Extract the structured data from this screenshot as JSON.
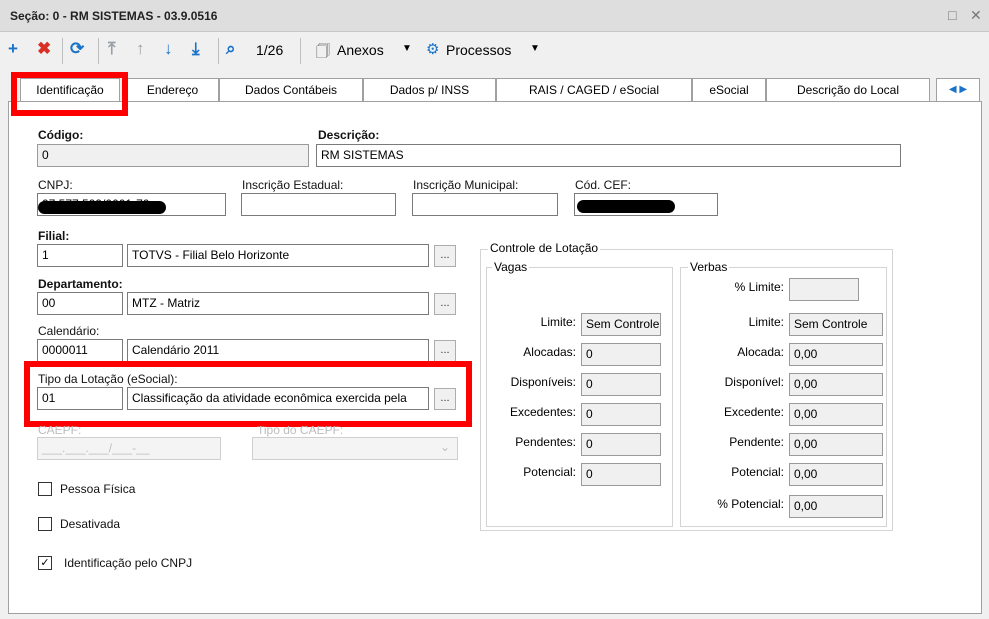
{
  "window": {
    "title": "Seção: 0 - RM SISTEMAS - 03.9.0516",
    "restore": "□",
    "close": "✕"
  },
  "toolbar": {
    "record_counter": "1/26",
    "attachments": "Anexos",
    "processes": "Processos"
  },
  "tabs": [
    "Identificação",
    "Endereço",
    "Dados Contábeis",
    "Dados p/ INSS",
    "RAIS / CAGED / eSocial",
    "eSocial",
    "Descrição do Local"
  ],
  "form": {
    "codigo_label": "Código:",
    "codigo_value": "0",
    "descricao_label": "Descrição:",
    "descricao_value": "RM SISTEMAS",
    "cnpj_label": "CNPJ:",
    "cnpj_value": "07.577.599/0001-70",
    "ie_label": "Inscrição Estadual:",
    "ie_value": "",
    "im_label": "Inscrição Municipal:",
    "im_value": "",
    "cef_label": "Cód. CEF:",
    "cef_value": "",
    "filial_label": "Filial:",
    "filial_code": "1",
    "filial_name": "TOTVS - Filial Belo Horizonte",
    "depto_label": "Departamento:",
    "depto_code": "00",
    "depto_name": "MTZ - Matriz",
    "cal_label": "Calendário:",
    "cal_code": "0000011",
    "cal_name": "Calendário 2011",
    "tipo_label": "Tipo da Lotação (eSocial):",
    "tipo_code": "01",
    "tipo_name": "Classificação da atividade econômica exercida pela",
    "caepf_label": "CAEPF:",
    "caepf_value": "___.___.___/___-__",
    "tipo_caepf_label": "Tipo do CAEPF:",
    "dots": "..."
  },
  "checkboxes": [
    {
      "label": "Pessoa Física",
      "checked": false
    },
    {
      "label": "Desativada",
      "checked": false
    },
    {
      "label": "Identificação pelo CNPJ",
      "checked": true
    }
  ],
  "controle": {
    "title": "Controle de Lotação",
    "vagas_title": "Vagas",
    "verbas_title": "Verbas",
    "vagas": [
      {
        "label": "Limite:",
        "value": "Sem Controle"
      },
      {
        "label": "Alocadas:",
        "value": "0"
      },
      {
        "label": "Disponíveis:",
        "value": "0"
      },
      {
        "label": "Excedentes:",
        "value": "0"
      },
      {
        "label": "Pendentes:",
        "value": "0"
      },
      {
        "label": "Potencial:",
        "value": "0"
      }
    ],
    "verbas": [
      {
        "label": "% Limite:",
        "value": ""
      },
      {
        "label": "Limite:",
        "value": "Sem Controle"
      },
      {
        "label": "Alocada:",
        "value": "0,00"
      },
      {
        "label": "Disponível:",
        "value": "0,00"
      },
      {
        "label": "Excedente:",
        "value": "0,00"
      },
      {
        "label": "Pendente:",
        "value": "0,00"
      },
      {
        "label": "Potencial:",
        "value": "0,00"
      },
      {
        "label": "% Potencial:",
        "value": "0,00"
      }
    ]
  },
  "colors": {
    "highlight": "#ff0000",
    "blue_icon": "#1a73c8",
    "red_icon": "#d93025"
  }
}
